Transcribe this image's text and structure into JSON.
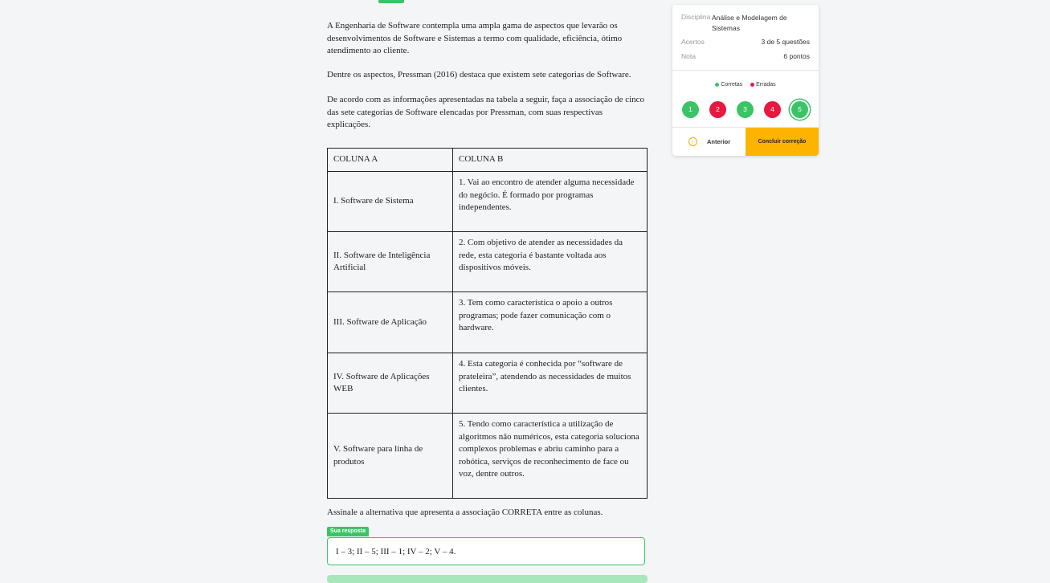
{
  "question": {
    "paragraphs": [
      "A Engenharia de Software contempla uma ampla gama de aspectos que levarão os desenvolvimentos de Software e Sistemas a termo com qualidade, eficiência, ótimo atendimento ao cliente.",
      "Dentre os aspectos, Pressman (2016) destaca que existem sete categorias de Software.",
      "De acordo com as informações apresentadas na tabela a seguir, faça a associação de cinco das sete categorias de Software elencadas por Pressman, com suas respectivas explicações."
    ],
    "table": {
      "headers": [
        "COLUNA A",
        "COLUNA B"
      ],
      "rows": [
        [
          "I. Software de Sistema",
          "1. Vai ao encontro de atender alguma necessidade do negócio. É formado por programas independentes."
        ],
        [
          "II. Software de Inteligência Artificial",
          "2. Com objetivo de atender as necessidades da rede, esta categoria é bastante voltada aos dispositivos móveis."
        ],
        [
          "III. Software de Aplicação",
          "3. Tem como característica o apoio a outros programas; pode fazer comunicação com o hardware."
        ],
        [
          "IV. Software de Aplicações WEB",
          "4. Esta categoria é conhecida por “software de prateleira”, atendendo as necessidades de muitos clientes."
        ],
        [
          "V. Software para linha de produtos",
          "5. Tendo como característica a utilização de algoritmos não numéricos, esta categoria soluciona complexos problemas e abriu caminho para a robótica, serviços de reconhecimento de face ou voz, dentre outros."
        ]
      ]
    },
    "instruction": "Assinale a alternativa que apresenta a associação CORRETA entre as colunas.",
    "answer_tag": "Sua resposta",
    "answer": "I – 3; II – 5; III – 1; IV – 2; V – 4."
  },
  "summary": {
    "discipline_label": "Disciplina",
    "discipline_value": "Análise e Modelagem de Sistemas",
    "hits_label": "Acertos",
    "hits_value": "3 de 5 questões",
    "grade_label": "Nota",
    "grade_value": "6 pontos",
    "legend_correct": "Corretas",
    "legend_wrong": "Erradas",
    "questions": [
      {
        "number": "1",
        "status": "correct"
      },
      {
        "number": "2",
        "status": "wrong"
      },
      {
        "number": "3",
        "status": "correct"
      },
      {
        "number": "4",
        "status": "wrong"
      },
      {
        "number": "5",
        "status": "correct",
        "current": true
      }
    ],
    "prev_label": "Anterior",
    "finish_label": "Concluir correção"
  },
  "colors": {
    "correct": "#3ac466",
    "wrong": "#e8183f",
    "accent": "#fdb400"
  },
  "icons": {
    "prev": "arrow-left-circle-icon"
  }
}
